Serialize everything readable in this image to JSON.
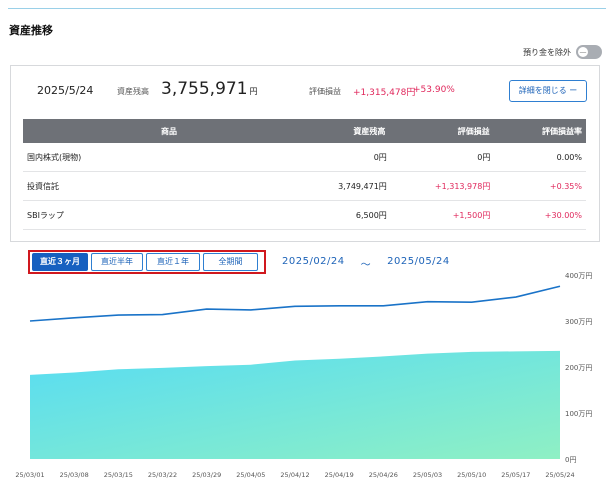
{
  "section_title": "資産推移",
  "toggle": {
    "label": "預り金を除外",
    "knob": "—"
  },
  "summary": {
    "date": "2025/5/24",
    "balance_label": "資産残高",
    "balance_value": "3,755,971",
    "balance_unit": "円",
    "pl_label": "評価損益",
    "pl_value": "+1,315,478円",
    "pl_rate": "+53.90%",
    "detail_button": "詳細を閉じる ー"
  },
  "table": {
    "headers": {
      "name": "商品",
      "balance": "資産残高",
      "pl": "評価損益",
      "rate": "評価損益率"
    },
    "rows": [
      {
        "name": "国内株式(現物)",
        "balance": "0円",
        "pl": "0円",
        "rate": "0.00%"
      },
      {
        "name": "投資信託",
        "balance": "3,749,471円",
        "pl": "+1,313,978円",
        "rate": "+0.35%"
      },
      {
        "name": "SBIラップ",
        "balance": "6,500円",
        "pl": "+1,500円",
        "rate": "+30.00%"
      }
    ]
  },
  "periods": [
    {
      "label": "直近３ヶ月",
      "active": true
    },
    {
      "label": "直近半年",
      "active": false
    },
    {
      "label": "直近１年",
      "active": false
    },
    {
      "label": "全期間",
      "active": false
    }
  ],
  "range": {
    "start": "2025/02/24",
    "sep": "～",
    "end": "2025/05/24"
  },
  "chart_data": {
    "type": "area",
    "x": [
      "25/03/01",
      "25/03/08",
      "25/03/15",
      "25/03/22",
      "25/03/29",
      "25/04/05",
      "25/04/12",
      "25/04/19",
      "25/04/26",
      "25/05/03",
      "25/05/10",
      "25/05/17",
      "25/05/24"
    ],
    "y_ticks": [
      "0円",
      "100万円",
      "200万円",
      "300万円",
      "400万円"
    ],
    "ylim": [
      0,
      4000000
    ],
    "series": [
      {
        "values": [
          3000000,
          3070000,
          3130000,
          3140000,
          3260000,
          3240000,
          3320000,
          3330000,
          3330000,
          3420000,
          3410000,
          3520000,
          3756000
        ],
        "color": "#1a73c8"
      },
      {
        "values": [
          1830000,
          1880000,
          1950000,
          1980000,
          2020000,
          2050000,
          2140000,
          2180000,
          2230000,
          2290000,
          2330000,
          2340000,
          2350000
        ],
        "color": "#4fe3ee"
      }
    ]
  }
}
